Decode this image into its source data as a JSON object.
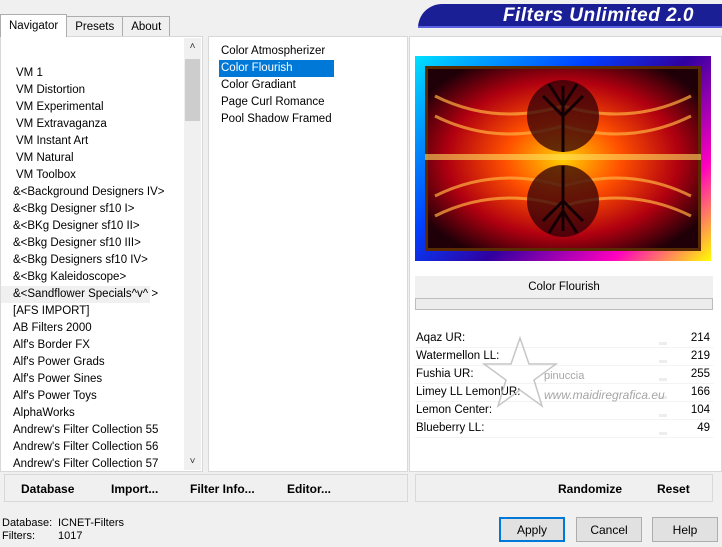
{
  "window": {
    "title": "Filters Unlimited 2.0"
  },
  "tabs": [
    {
      "label": "Navigator",
      "active": true
    },
    {
      "label": "Presets",
      "active": false
    },
    {
      "label": "About",
      "active": false
    }
  ],
  "filter_list": {
    "items": [
      "VM 1",
      "VM Distortion",
      "VM Experimental",
      "VM Extravaganza",
      "VM Instant Art",
      "VM Natural",
      "VM Toolbox",
      "&<Background Designers IV>",
      "&<Bkg Designer sf10 I>",
      "&<BKg Designer sf10 II>",
      "&<Bkg Designer sf10 III>",
      "&<Bkg Designers sf10 IV>",
      "&<Bkg Kaleidoscope>",
      "&<Sandflower Specials^v^ >",
      "[AFS IMPORT]",
      "AB Filters 2000",
      "Alf's Border FX",
      "Alf's Power Grads",
      "Alf's Power Sines",
      "Alf's Power Toys",
      "AlphaWorks",
      "Andrew's Filter Collection 55",
      "Andrew's Filter Collection 56",
      "Andrew's Filter Collection 57"
    ],
    "selected_index": 13
  },
  "sub_filters": {
    "items": [
      "Color Atmospherizer",
      "Color Flourish",
      "Color Gradiant",
      "Page Curl Romance",
      "Pool Shadow Framed"
    ],
    "selected_index": 1
  },
  "preview": {
    "filter_name": "Color Flourish"
  },
  "parameters": [
    {
      "label": "Aqaz UR:",
      "value": "214"
    },
    {
      "label": "Watermellon LL:",
      "value": "219"
    },
    {
      "label": "Fushia UR:",
      "value": "255"
    },
    {
      "label": "Limey LL LemonUR:",
      "value": "166"
    },
    {
      "label": "Lemon Center:",
      "value": "104"
    },
    {
      "label": "Blueberry LL:",
      "value": "49"
    }
  ],
  "watermark": {
    "line1": "pinuccia",
    "line2": "www.maidiregrafica.eu"
  },
  "left_buttons": {
    "database": "Database",
    "import": "Import...",
    "filter_info": "Filter Info...",
    "editor": "Editor..."
  },
  "right_buttons": {
    "randomize": "Randomize",
    "reset": "Reset"
  },
  "status": {
    "database_label": "Database:",
    "database_value": "ICNET-Filters",
    "filters_label": "Filters:",
    "filters_value": "1017"
  },
  "dialog_buttons": {
    "apply": "Apply",
    "cancel": "Cancel",
    "help": "Help"
  },
  "colors": {
    "banner": "#1b1f96",
    "selection": "#0078d7"
  }
}
